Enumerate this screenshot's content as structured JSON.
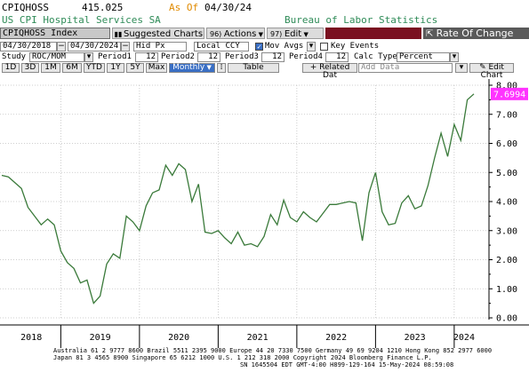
{
  "header": {
    "ticker": "CPIQHOSS",
    "last_value": "415.025",
    "as_of_label": "As Of",
    "as_of_date": "04/30/24",
    "description": "US CPI Hospital Services SA",
    "source": "Bureau of Labor Statistics"
  },
  "toolbar": {
    "security": "CPIQHOSS Index",
    "suggested_charts": "Suggested Charts",
    "actions": "Actions",
    "edit": "Edit",
    "rate_of_change": "Rate Of Change"
  },
  "row2": {
    "start_date": "04/30/2018",
    "end_date": "04/30/2024",
    "field": "Hid Px",
    "currency": "Local CCY",
    "mov_avgs": "Mov Avgs",
    "key_events": "Key Events"
  },
  "row3": {
    "study_label": "Study",
    "study_value": "ROC/MOM",
    "period1_label": "Period1",
    "period1_value": "12",
    "period2_label": "Period2",
    "period2_value": "12",
    "period3_label": "Period3",
    "period3_value": "12",
    "period4_label": "Period4",
    "period4_value": "12",
    "calc_type_label": "Calc Type",
    "calc_type_value": "Percent"
  },
  "row4": {
    "ranges": [
      "1D",
      "3D",
      "1M",
      "6M",
      "YTD",
      "1Y",
      "5Y",
      "Max"
    ],
    "frequency": "Monthly",
    "table": "Table",
    "related_data": "Related Dat",
    "add_data": "Add Data",
    "edit_chart": "Edit Chart"
  },
  "colors": {
    "line": "#3a7a3a",
    "last_label_bg": "#ff33ff",
    "header_green": "#2e8b57",
    "as_of_orange": "#e08a00",
    "toolbar_darkred": "#7a1020"
  },
  "chart_data": {
    "type": "line",
    "last_label": "7.6994",
    "ylim": [
      0,
      8
    ],
    "yticks": [
      "0.00",
      "1.00",
      "2.00",
      "3.00",
      "4.00",
      "5.00",
      "6.00",
      "7.00",
      "8.00"
    ],
    "xlabels": [
      "2018",
      "2019",
      "2020",
      "2021",
      "2022",
      "2023",
      "2024"
    ],
    "x_start": "2018-04",
    "series": [
      {
        "values": [
          4.9,
          4.85,
          4.65,
          4.45,
          3.8,
          3.5,
          3.2,
          3.4,
          3.2,
          2.3,
          1.9,
          1.7,
          1.2,
          1.3,
          0.5,
          0.75,
          1.85,
          2.2,
          2.05,
          3.5,
          3.3,
          3.0,
          3.85,
          4.3,
          4.4,
          5.25,
          4.9,
          5.3,
          5.1,
          4.0,
          4.6,
          2.95,
          2.9,
          3.0,
          2.75,
          2.55,
          2.95,
          2.5,
          2.55,
          2.45,
          2.8,
          3.55,
          3.2,
          4.05,
          3.45,
          3.3,
          3.65,
          3.45,
          3.3,
          3.6,
          3.9,
          3.9,
          3.95,
          4.0,
          3.95,
          2.65,
          4.3,
          5.0,
          3.65,
          3.2,
          3.25,
          3.95,
          4.2,
          3.75,
          3.85,
          4.55,
          5.5,
          6.35,
          5.55,
          6.65,
          6.1,
          7.5,
          7.6994
        ]
      }
    ]
  },
  "footer": {
    "line1": "Australia 61 2 9777 8600 Brazil 5511 2395 9000 Europe 44 20 7330 7500 Germany 49 69 9204 1210 Hong Kong 852 2977 6000",
    "line2": "Japan 81 3 4565 8900         Singapore 65 6212 1000         U.S. 1 212 318 2000              Copyright 2024 Bloomberg Finance L.P.",
    "line3": "SN 1645504 EDT  GMT-4:00 H899-129-164 15-May-2024 08:59:08"
  }
}
